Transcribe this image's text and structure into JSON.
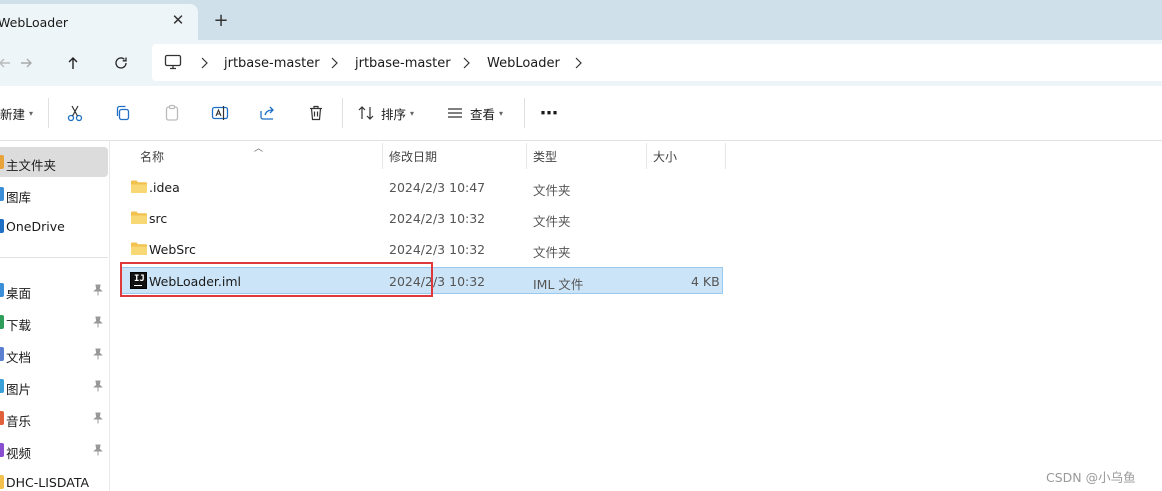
{
  "tab": {
    "title": "WebLoader",
    "close_glyph": "✕",
    "new_glyph": "+"
  },
  "nav": {
    "back_icon": "arrow-left-icon",
    "forward_icon": "arrow-right-icon",
    "up_icon": "arrow-up-icon",
    "refresh_icon": "refresh-icon",
    "breadcrumbs": [
      "jrtbase-master",
      "jrtbase-master",
      "WebLoader"
    ]
  },
  "toolbar": {
    "new_label": "新建",
    "sort_label": "排序",
    "view_label": "查看",
    "more_glyph": "⋯"
  },
  "sidebar": {
    "items": [
      {
        "label": "主文件夹",
        "icon": "home-icon",
        "color": "#e8a33a",
        "active": true
      },
      {
        "label": "图库",
        "icon": "gallery-icon",
        "color": "#3a8fd8"
      },
      {
        "label": "OneDrive",
        "icon": "cloud-icon",
        "color": "#1f6fc5"
      },
      {
        "label": "桌面",
        "icon": "desktop-icon",
        "color": "#3a8fd8",
        "pinned": true
      },
      {
        "label": "下载",
        "icon": "download-icon",
        "color": "#2f9e5b",
        "pinned": true
      },
      {
        "label": "文档",
        "icon": "document-icon",
        "color": "#5a7fd0",
        "pinned": true
      },
      {
        "label": "图片",
        "icon": "picture-icon",
        "color": "#3aa0d8",
        "pinned": true
      },
      {
        "label": "音乐",
        "icon": "music-icon",
        "color": "#e0603a",
        "pinned": true
      },
      {
        "label": "视频",
        "icon": "video-icon",
        "color": "#8a4fd0",
        "pinned": true
      },
      {
        "label": "DHC-LISDATA",
        "icon": "folder-icon",
        "color": "#f2c14e"
      }
    ]
  },
  "columns": {
    "name": "名称",
    "modified": "修改日期",
    "type": "类型",
    "size": "大小"
  },
  "files": [
    {
      "name": ".idea",
      "modified": "2024/2/3 10:47",
      "type": "文件夹",
      "size": "",
      "kind": "folder"
    },
    {
      "name": "src",
      "modified": "2024/2/3 10:32",
      "type": "文件夹",
      "size": "",
      "kind": "folder"
    },
    {
      "name": "WebSrc",
      "modified": "2024/2/3 10:32",
      "type": "文件夹",
      "size": "",
      "kind": "folder"
    },
    {
      "name": "WebLoader.iml",
      "modified": "2024/2/3 10:32",
      "type": "IML 文件",
      "size": "4 KB",
      "kind": "intellij",
      "selected": true
    }
  ],
  "watermark": "CSDN @小乌鱼",
  "colors": {
    "accent_selection": "#cce4f7",
    "highlight_box": "#e0393b",
    "folder": "#f2c14e"
  }
}
